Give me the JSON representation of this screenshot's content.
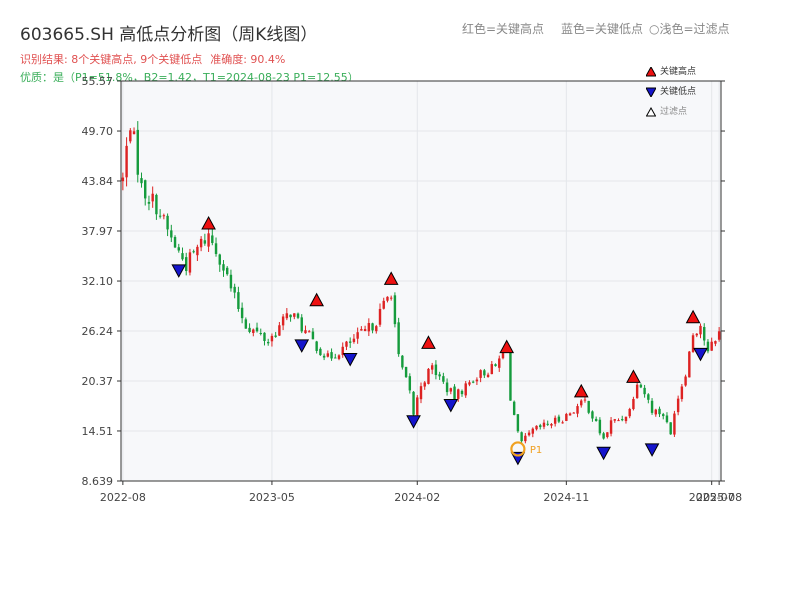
{
  "title": "603665.SH 高低点分析图（周K线图）",
  "top_legend": {
    "red": "红色=关键高点",
    "blue": "蓝色=关键低点",
    "filtered": "○浅色=过滤点"
  },
  "info_line1": {
    "result": "识别结果: 8个关键高点, 9个关键低点",
    "accuracy": "准确度: 90.4%"
  },
  "info_line2": "优质：是（P1=51.8%，B2=1.42，T1=2024-08-23 P1=12.55）",
  "legend": {
    "high": "关键高点",
    "low": "关键低点",
    "filtered": "过滤点"
  },
  "marker_label": "P1",
  "colors": {
    "up": "#dd2222",
    "down": "#159b3c",
    "high_marker": "#ee1111",
    "low_marker": "#1515cc",
    "filtered_ring": "#f0a020",
    "plot_bg": "#f7f8fa",
    "grid": "#e4e6ea"
  },
  "chart_data": {
    "type": "candlestick",
    "x_ticks": [
      "2022-08",
      "2023-05",
      "2024-02",
      "2024-11",
      "2025-07",
      "2025-08"
    ],
    "x_tick_pos": [
      0,
      40,
      79,
      119,
      158,
      160
    ],
    "y_ticks": [
      "8.639",
      "14.51",
      "20.37",
      "26.24",
      "32.10",
      "37.97",
      "43.84",
      "49.70",
      "55.57"
    ],
    "ylim": [
      8.639,
      55.57
    ],
    "xlim": [
      -0.5,
      160.5
    ],
    "anchors": [
      [
        0,
        44
      ],
      [
        2,
        51
      ],
      [
        5,
        43
      ],
      [
        9,
        41
      ],
      [
        13,
        37
      ],
      [
        17,
        34
      ],
      [
        21,
        36.5
      ],
      [
        23,
        37.5
      ],
      [
        26,
        35
      ],
      [
        30,
        30
      ],
      [
        33,
        27
      ],
      [
        39,
        25
      ],
      [
        45,
        28.5
      ],
      [
        50,
        25.5
      ],
      [
        55,
        23
      ],
      [
        60,
        24.5
      ],
      [
        66,
        26.5
      ],
      [
        68,
        27.5
      ],
      [
        72,
        31
      ],
      [
        74,
        23
      ],
      [
        77,
        19
      ],
      [
        78,
        16.5
      ],
      [
        80,
        20
      ],
      [
        83,
        22
      ],
      [
        87,
        19.5
      ],
      [
        89,
        18.5
      ],
      [
        95,
        21
      ],
      [
        100,
        22
      ],
      [
        103,
        24.5
      ],
      [
        104,
        18
      ],
      [
        106,
        14
      ],
      [
        107,
        13
      ],
      [
        110,
        14.5
      ],
      [
        115,
        15.5
      ],
      [
        118,
        16
      ],
      [
        121,
        17
      ],
      [
        124,
        18
      ],
      [
        129,
        13.5
      ],
      [
        131,
        15.5
      ],
      [
        134,
        16
      ],
      [
        136,
        17
      ],
      [
        138,
        20.5
      ],
      [
        140,
        19
      ],
      [
        142,
        17
      ],
      [
        145,
        16.5
      ],
      [
        147,
        14
      ],
      [
        148,
        17
      ],
      [
        151,
        21.5
      ],
      [
        153,
        26
      ],
      [
        155,
        27
      ],
      [
        157,
        23.5
      ],
      [
        159,
        25.5
      ],
      [
        160,
        26
      ]
    ],
    "highs": [
      {
        "i": 23,
        "price": 37.5
      },
      {
        "i": 52,
        "price": 28.5
      },
      {
        "i": 72,
        "price": 31.0
      },
      {
        "i": 82,
        "price": 23.5
      },
      {
        "i": 103,
        "price": 23.0
      },
      {
        "i": 123,
        "price": 17.8
      },
      {
        "i": 137,
        "price": 19.5
      },
      {
        "i": 153,
        "price": 26.5
      }
    ],
    "lows": [
      {
        "i": 15,
        "price": 34.0
      },
      {
        "i": 48,
        "price": 25.2
      },
      {
        "i": 61,
        "price": 23.6
      },
      {
        "i": 78,
        "price": 16.3
      },
      {
        "i": 88,
        "price": 18.2
      },
      {
        "i": 106,
        "price": 12.0
      },
      {
        "i": 129,
        "price": 12.6
      },
      {
        "i": 142,
        "price": 13.0
      },
      {
        "i": 155,
        "price": 24.2
      }
    ],
    "filtered": [
      {
        "i": 106,
        "price": 12.4,
        "label": "P1"
      }
    ]
  }
}
